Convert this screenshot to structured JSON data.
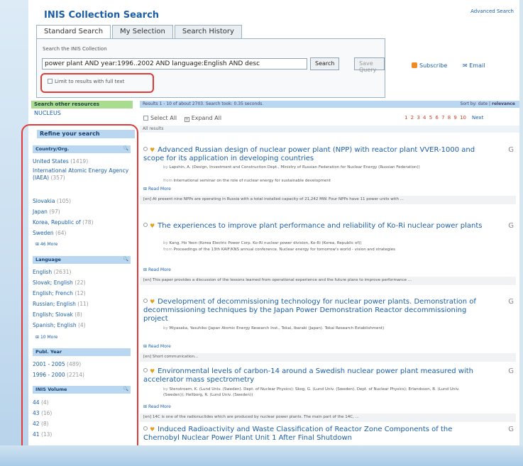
{
  "app": {
    "title": "INIS Collection Search",
    "advanced_link": "Advanced Search"
  },
  "tabs": [
    {
      "label": "Standard Search",
      "active": true
    },
    {
      "label": "My Selection",
      "active": false
    },
    {
      "label": "Search History",
      "active": false
    }
  ],
  "search": {
    "label": "Search the INIS Collection",
    "query": "power plant AND year:1996..2002 AND language:English AND desc",
    "search_button": "Search",
    "save_button": "Save Query",
    "subscribe_link": "Subscribe",
    "email_link": "Email",
    "fulltext_label": "Limit to results with full text"
  },
  "other_resources": {
    "heading": "Search other resources",
    "items": [
      "NUCLEUS"
    ]
  },
  "refine": {
    "heading": "Refine your search",
    "country": {
      "heading": "Country/Org.",
      "items": [
        {
          "label": "United States",
          "count": "(1419)"
        },
        {
          "label": "International Atomic Energy Agency (IAEA)",
          "count": "(357)"
        },
        {
          "label": "Slovakia",
          "count": "(105)"
        },
        {
          "label": "Japan",
          "count": "(97)"
        },
        {
          "label": "Korea, Republic of",
          "count": "(78)"
        },
        {
          "label": "Sweden",
          "count": "(64)"
        }
      ],
      "more": "46 More"
    },
    "language": {
      "heading": "Language",
      "items": [
        {
          "label": "English",
          "count": "(2631)"
        },
        {
          "label": "Slovak; English",
          "count": "(22)"
        },
        {
          "label": "English; French",
          "count": "(12)"
        },
        {
          "label": "Russian; English",
          "count": "(11)"
        },
        {
          "label": "English; Slovak",
          "count": "(8)"
        },
        {
          "label": "Spanish; English",
          "count": "(4)"
        }
      ],
      "more": "10 More"
    },
    "year": {
      "heading": "Publ. Year",
      "items": [
        {
          "label": "2001 - 2005",
          "count": "(489)"
        },
        {
          "label": "1996 - 2000",
          "count": "(2214)"
        }
      ]
    },
    "volume": {
      "heading": "INIS Volume",
      "items": [
        {
          "label": "44",
          "count": "(4)"
        },
        {
          "label": "43",
          "count": "(16)"
        },
        {
          "label": "42",
          "count": "(8)"
        },
        {
          "label": "41",
          "count": "(13)"
        }
      ]
    }
  },
  "results": {
    "summary": "Results 1 - 10 of about 2703. Search took: 0.35 seconds.",
    "sort_label": "Sort by:",
    "sort_date": "date",
    "sort_relevance": "relevance",
    "select_all": "Select All",
    "expand_all": "Expand All",
    "pages": "1 2 3 4 5 6 7 8 9 10",
    "next": "Next",
    "all_results": "All results",
    "read_more": "Read More",
    "items": [
      {
        "title": "Advanced Russian design of nuclear power plant (NPP) with reactor plant VVER-1000 and scope for its application in developing countries",
        "by_label": "by",
        "by": "Lapshin, A. (Design, Investment and Construction Dept., Ministry of Russian Federation for Nuclear Energy (Russian Federation))",
        "from_label": "from",
        "from": "International seminar on the role of nuclear energy for sustainable development",
        "snippet": "[en] At present nine NPPs are operating in Russia with a total installed capacity of 21,242 MW. Four NPPs have 11 power units with ..."
      },
      {
        "title": "The experiences to improve plant performance and reliability of Ko-Ri nuclear power plants",
        "by_label": "by",
        "by": "Kang, Ho Yeon (Korea Electric Power Corp. Ko-Ri nuclear power division, Ko-Ri (Korea, Republic of))",
        "from_label": "from",
        "from": "Proceedings of the 13th KAIF/KNS annual conference. Nuclear energy for tomorrow's world - vision and strategies",
        "snippet": "[en] This paper provides a discussion of the lessons learned from operational experience and the future plans to improve performance ..."
      },
      {
        "title": "Development of decommissioning technology for nuclear power plants. Demonstration of decommissioning techniques by the Japan Power Demonstration Reactor decommissioning project",
        "by_label": "by",
        "by": "Miyasaka, Yasuhiko (Japan Atomic Energy Research Inst., Tokai, Ibaraki (Japan). Tokai Research Establishment)",
        "from_label": "",
        "from": "",
        "snippet": "[en] Short communication..."
      },
      {
        "title": "Environmental levels of carbon-14 around a Swedish nuclear power plant measured with accelerator mass spectrometry",
        "by_label": "by",
        "by": "Stenstroem, K. (Lund Univ. (Sweden). Dept. of Nuclear Physics); Skog, G. (Lund Univ. (Sweden). Dept. of Nuclear Physics); Erlandsson, B. (Lund Univ. (Sweden)); Hellborg, R. (Lund Univ. (Sweden))",
        "from_label": "",
        "from": "",
        "snippet": "[en] 14C is one of the radionuclides which are produced by nuclear power plants. The main part of the 14C, ..."
      },
      {
        "title": "Induced Radioactivity and Waste Classification of Reactor Zone Components of the Chernobyl Nuclear Power Plant Unit 1 After Final Shutdown",
        "by_label": "",
        "by": "",
        "from_label": "",
        "from": "",
        "snippet": ""
      }
    ]
  },
  "colors": {
    "accent": "#1b5fa8",
    "highlight_box": "#e03a3a",
    "facet_head_bg": "#b9d7f1",
    "other_head_bg": "#a9dc8e"
  }
}
